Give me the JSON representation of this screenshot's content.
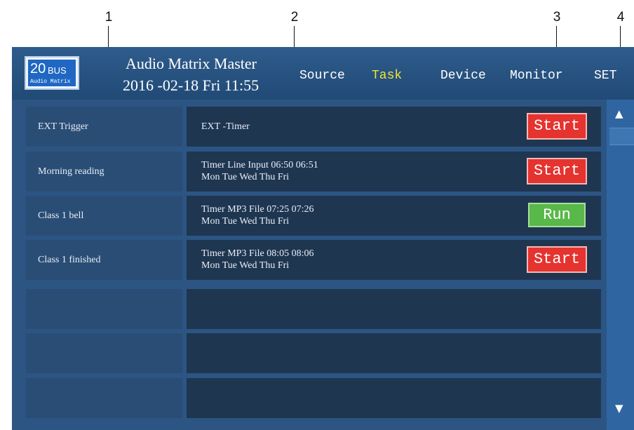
{
  "callouts": [
    "1",
    "2",
    "3",
    "4"
  ],
  "header": {
    "logo_number": "20",
    "logo_bus": "BUS",
    "logo_subtitle": "Audio Matrix",
    "title": "Audio Matrix Master",
    "datetime": "2016 -02-18  Fri  11:55"
  },
  "nav": {
    "items": [
      "Source",
      "Task",
      "Device",
      "Monitor",
      "SET"
    ],
    "active": "Task",
    "active_color": "#f2e33c"
  },
  "tasks": [
    {
      "name": "EXT Trigger",
      "detail_line1": "EXT -Timer",
      "detail_line2": "",
      "action": "Start"
    },
    {
      "name": "Morning reading",
      "detail_line1": "Timer  Line Input  06:50  06:51",
      "detail_line2": "Mon  Tue  Wed  Thu  Fri",
      "action": "Start"
    },
    {
      "name": "Class 1 bell",
      "detail_line1": "Timer  MP3 File  07:25  07:26",
      "detail_line2": "Mon  Tue  Wed  Thu  Fri",
      "action": "Run"
    },
    {
      "name": "Class 1 finished",
      "detail_line1": "Timer  MP3 File  08:05  08:06",
      "detail_line2": "Mon  Tue  Wed  Thu  Fri",
      "action": "Start"
    }
  ],
  "empty_rows": 3,
  "colors": {
    "start_button": "#e5332f",
    "run_button": "#59b84a",
    "panel_background": "#2c5584"
  },
  "scrollbar": {
    "up_icon": "triangle-up-icon",
    "down_icon": "triangle-down-icon"
  }
}
